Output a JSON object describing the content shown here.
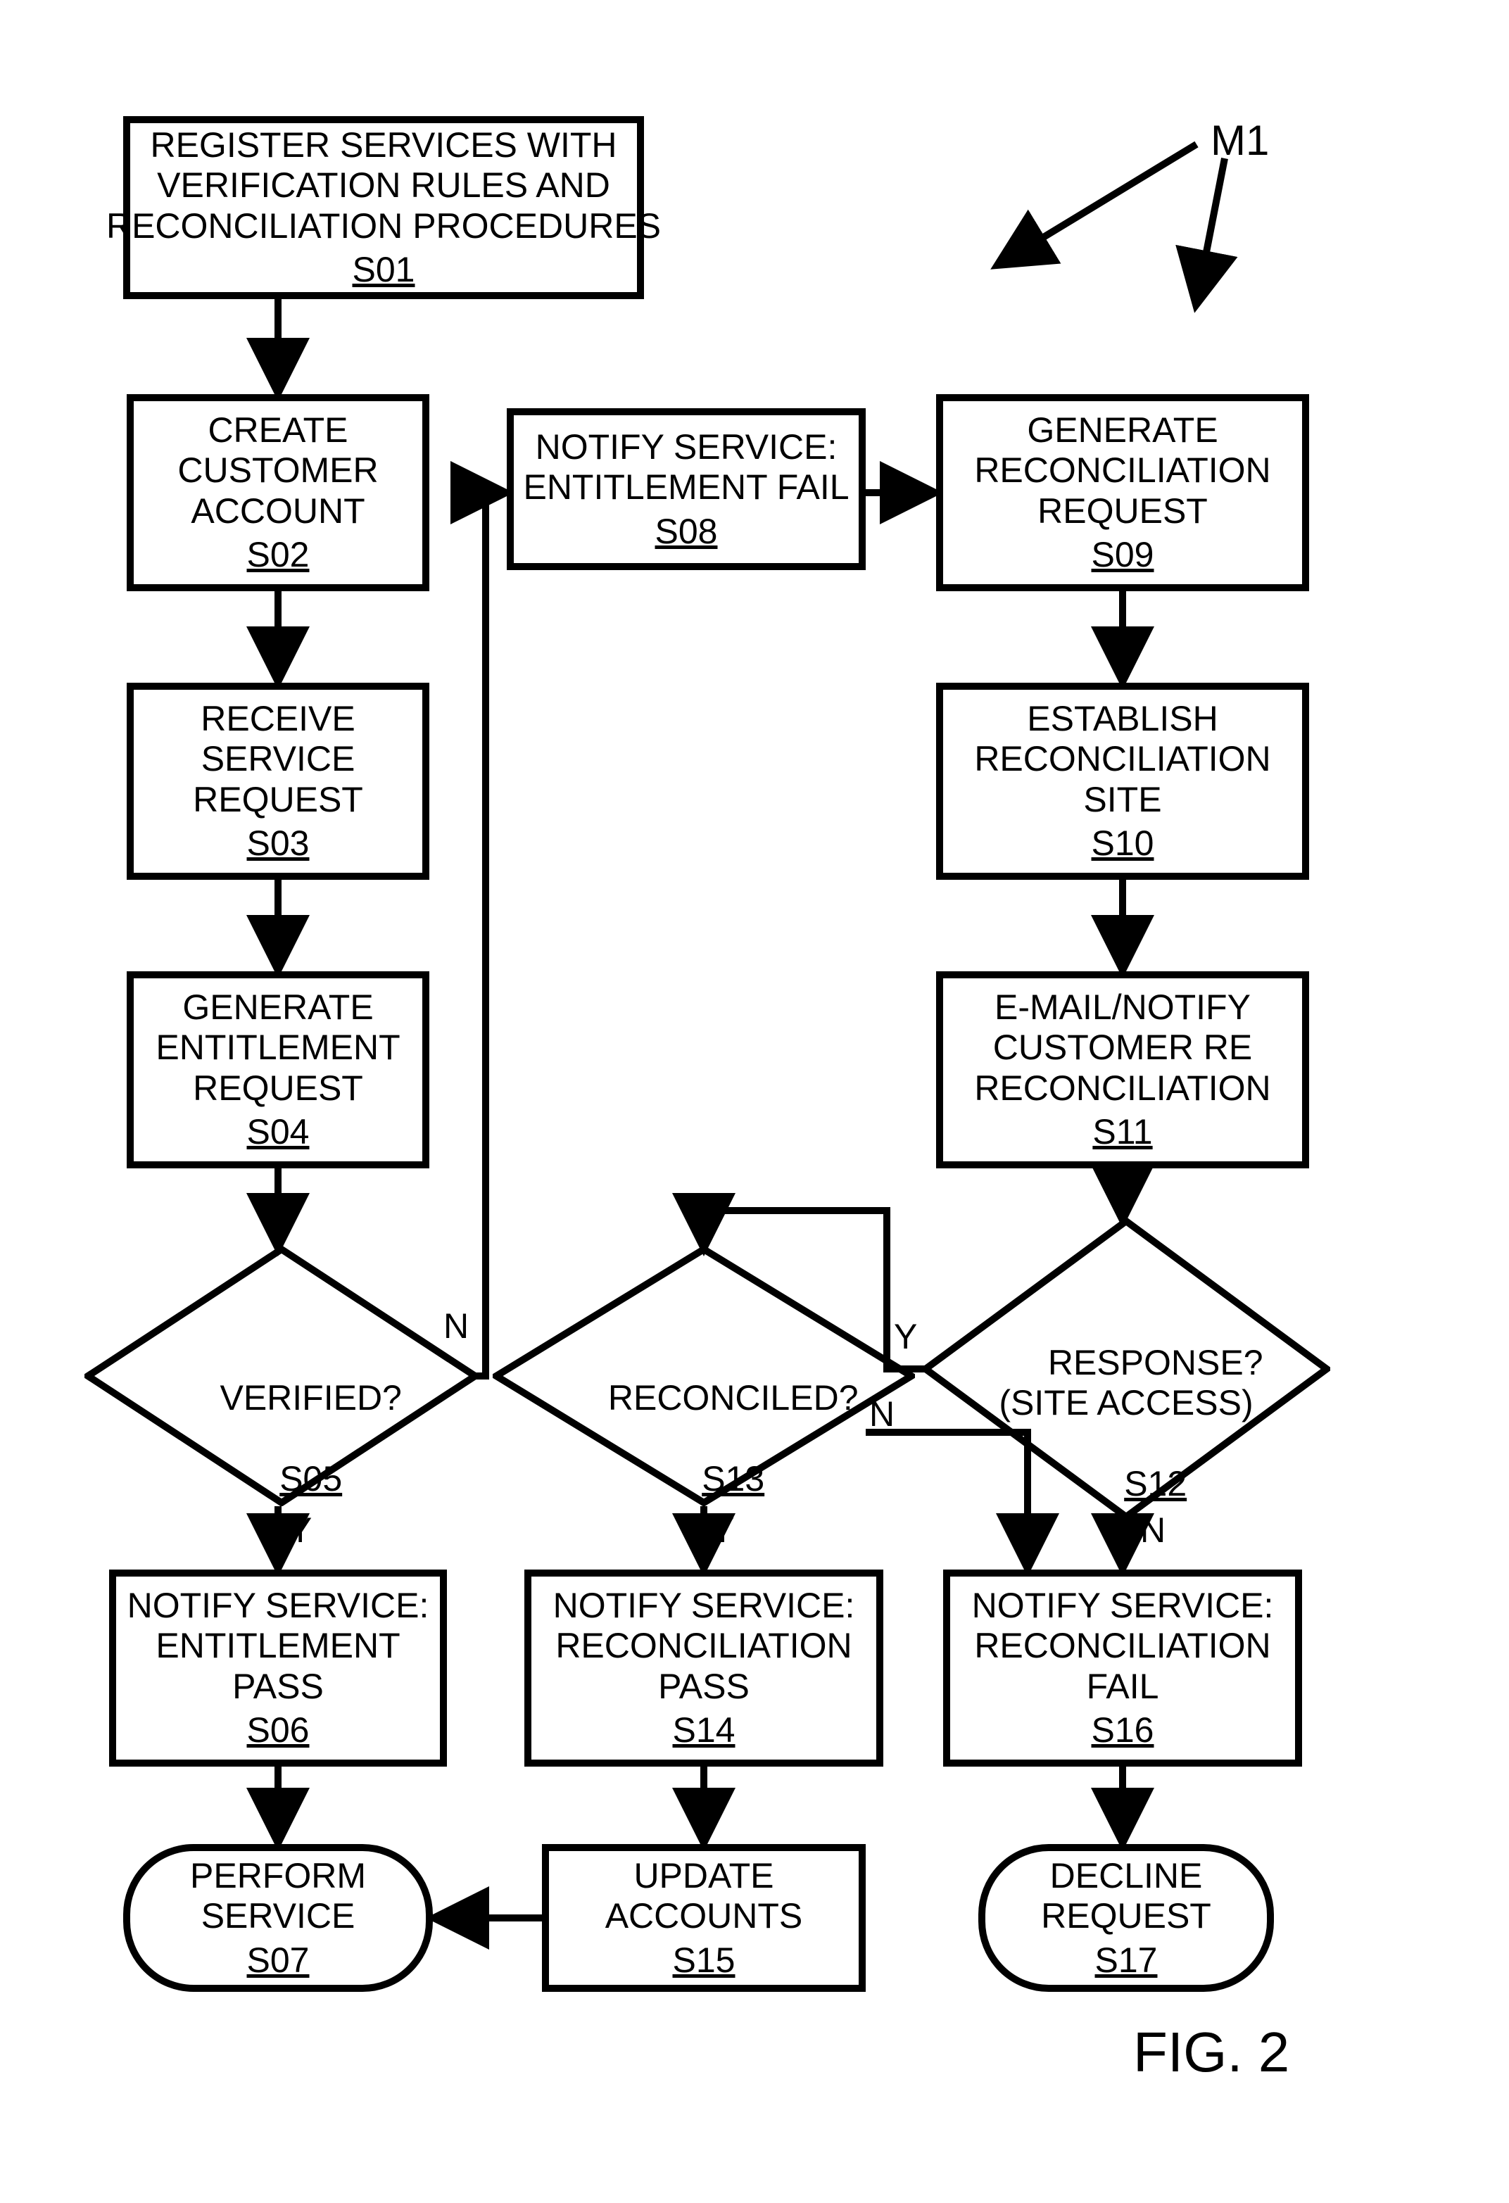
{
  "figure_label": "FIG. 2",
  "marker": "M1",
  "nodes": {
    "s01": {
      "lines": "REGISTER SERVICES WITH\nVERIFICATION RULES AND\nRECONCILIATION PROCEDURES",
      "step": "S01"
    },
    "s02": {
      "lines": "CREATE\nCUSTOMER\nACCOUNT",
      "step": "S02"
    },
    "s03": {
      "lines": "RECEIVE\nSERVICE\nREQUEST",
      "step": "S03"
    },
    "s04": {
      "lines": "GENERATE\nENTITLEMENT\nREQUEST",
      "step": "S04"
    },
    "s05": {
      "question": "VERIFIED?",
      "step": "S05"
    },
    "s06": {
      "lines": "NOTIFY SERVICE:\nENTITLEMENT\nPASS",
      "step": "S06"
    },
    "s07": {
      "lines": "PERFORM\nSERVICE",
      "step": "S07"
    },
    "s08": {
      "lines": "NOTIFY SERVICE:\nENTITLEMENT FAIL",
      "step": "S08"
    },
    "s09": {
      "lines": "GENERATE\nRECONCILIATION\nREQUEST",
      "step": "S09"
    },
    "s10": {
      "lines": "ESTABLISH\nRECONCILIATION\nSITE",
      "step": "S10"
    },
    "s11": {
      "lines": "E-MAIL/NOTIFY\nCUSTOMER RE\nRECONCILIATION",
      "step": "S11"
    },
    "s12": {
      "question": "RESPONSE?\n(SITE ACCESS)",
      "step": "S12"
    },
    "s13": {
      "question": "RECONCILED?",
      "step": "S13"
    },
    "s14": {
      "lines": "NOTIFY SERVICE:\nRECONCILIATION\nPASS",
      "step": "S14"
    },
    "s15": {
      "lines": "UPDATE\nACCOUNTS",
      "step": "S15"
    },
    "s16": {
      "lines": "NOTIFY SERVICE:\nRECONCILIATION\nFAIL",
      "step": "S16"
    },
    "s17": {
      "lines": "DECLINE\nREQUEST",
      "step": "S17"
    }
  },
  "labels": {
    "Y": "Y",
    "N": "N"
  }
}
